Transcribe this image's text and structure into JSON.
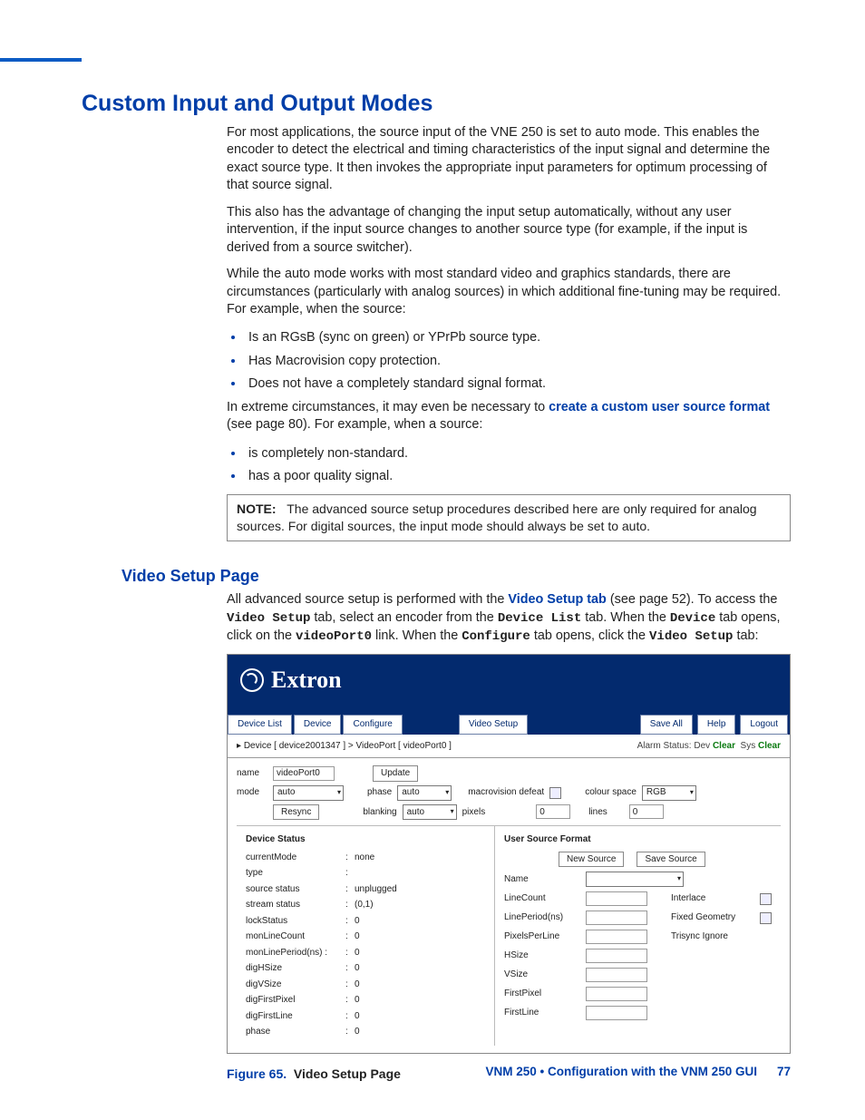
{
  "heading": "Custom Input and Output Modes",
  "para1": "For most applications, the source input of the VNE 250 is set to auto mode. This enables the encoder to detect the electrical and timing characteristics of the input signal and determine the exact source type. It then invokes the appropriate input parameters for optimum processing of that source signal.",
  "para2": "This also has the advantage of changing the input setup automatically, without any user intervention, if the input source changes to another source type (for example, if the input is derived from a source switcher).",
  "para3": "While the auto mode works with most standard video and graphics standards, there are circumstances (particularly with analog sources) in which additional fine-tuning may be required. For example, when the source:",
  "bullets1": [
    "Is an RGsB (sync on green) or YPrPb source type.",
    "Has Macrovision copy protection.",
    "Does not have a completely standard signal format."
  ],
  "para4_pre": "In extreme circumstances, it may even be necessary to ",
  "para4_link": "create a custom user source format",
  "para4_post": " (see page 80). For example, when a source:",
  "bullets2": [
    "is completely non-standard.",
    "has a poor quality signal."
  ],
  "note_label": "NOTE:",
  "note_text": "The advanced source setup procedures described here are only required for analog sources. For digital sources, the input mode should always be set to auto.",
  "sub_heading": "Video Setup Page",
  "vsp_pre": "All advanced source setup is performed with the ",
  "vsp_link": "Video Setup tab",
  "vsp_mid1": " (see page 52). To access the ",
  "vsp_mono1": "Video Setup",
  "vsp_mid2": " tab, select an encoder from the ",
  "vsp_mono2": "Device List",
  "vsp_mid3": " tab. When the ",
  "vsp_mono3": "Device",
  "vsp_mid4": " tab opens, click on the ",
  "vsp_mono4": "videoPort0",
  "vsp_mid5": " link. When the ",
  "vsp_mono5": "Configure",
  "vsp_mid6": " tab opens, click the ",
  "vsp_mono6": "Video Setup",
  "vsp_end": " tab:",
  "gui": {
    "brand": "Extron",
    "tabs": {
      "device_list": "Device List",
      "device": "Device",
      "configure": "Configure",
      "video_setup": "Video Setup"
    },
    "actions": {
      "save_all": "Save All",
      "help": "Help",
      "logout": "Logout"
    },
    "crumb": "Device [ device2001347 ]  >  VideoPort [ videoPort0 ]",
    "alarm_label": "Alarm Status:",
    "alarm_dev": "Dev",
    "alarm_sys": "Sys",
    "clear": "Clear",
    "form": {
      "name_lbl": "name",
      "name_val": "videoPort0",
      "update": "Update",
      "mode_lbl": "mode",
      "mode_val": "auto",
      "phase_lbl": "phase",
      "phase_val": "auto",
      "macro_lbl": "macrovision defeat",
      "cs_lbl": "colour space",
      "cs_val": "RGB",
      "resync": "Resync",
      "blank_lbl": "blanking",
      "blank_val": "auto",
      "pixels": "pixels",
      "pixels_val": "0",
      "lines": "lines",
      "lines_val": "0"
    },
    "status_title": "Device Status",
    "status": [
      [
        "currentMode",
        "none"
      ],
      [
        "type",
        ""
      ],
      [
        "source status",
        "unplugged"
      ],
      [
        "stream status",
        "(0,1)"
      ],
      [
        "lockStatus",
        "0"
      ],
      [
        "monLineCount",
        "0"
      ],
      [
        "monLinePeriod(ns) :",
        "0"
      ],
      [
        "digHSize",
        "0"
      ],
      [
        "digVSize",
        "0"
      ],
      [
        "digFirstPixel",
        "0"
      ],
      [
        "digFirstLine",
        "0"
      ],
      [
        "phase",
        "0"
      ]
    ],
    "usf_title": "User Source Format",
    "usf_new": "New Source",
    "usf_save": "Save Source",
    "usf_fields_left": [
      "Name",
      "LineCount",
      "LinePeriod(ns)",
      "PixelsPerLine",
      "HSize",
      "VSize",
      "FirstPixel",
      "FirstLine"
    ],
    "usf_right": [
      [
        "Interlace",
        "chk"
      ],
      [
        "Fixed Geometry",
        "chk"
      ],
      [
        "Trisync Ignore",
        ""
      ]
    ]
  },
  "figure_label": "Figure 65.",
  "figure_title": "Video Setup Page",
  "footer_text": "VNM 250 • Configuration with the VNM 250 GUI",
  "page_no": "77"
}
